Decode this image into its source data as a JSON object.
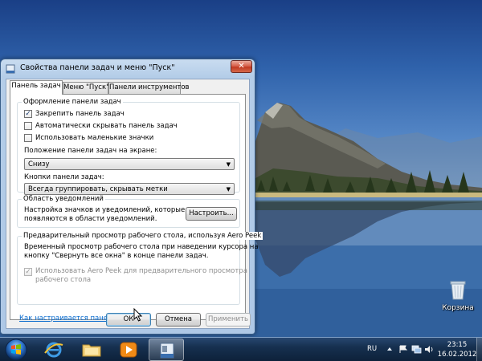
{
  "window": {
    "title": "Свойства панели задач и меню \"Пуск\"",
    "close_symbol": "✕"
  },
  "tabs": [
    {
      "label": "Панель задач",
      "active": true
    },
    {
      "label": "Меню \"Пуск\"",
      "active": false
    },
    {
      "label": "Панели инструментов",
      "active": false
    }
  ],
  "taskbar_appearance": {
    "caption": "Оформление панели задач",
    "lock_taskbar": {
      "label": "Закрепить панель задач",
      "checked": true,
      "mark": "✓"
    },
    "auto_hide": {
      "label": "Автоматически скрывать панель задач",
      "checked": false
    },
    "small_icons": {
      "label": "Использовать маленькие значки",
      "checked": false
    },
    "location_label": "Положение панели задач на экране:",
    "location_value": "Снизу",
    "buttons_label": "Кнопки панели задач:",
    "buttons_value": "Всегда группировать, скрывать метки"
  },
  "notification_area": {
    "caption": "Область уведомлений",
    "text_line1": "Настройка значков и уведомлений, которые",
    "text_line2": "появляются в области уведомлений.",
    "customize_button": "Настроить..."
  },
  "aero_peek": {
    "caption": "Предварительный просмотр рабочего стола, используя Aero Peek",
    "text_line1": "Временный просмотр рабочего стола при наведении курсора на",
    "text_line2": "кнопку \"Свернуть все окна\" в конце панели задач.",
    "checkbox_line1": "Использовать Aero Peek для предварительного просмотра",
    "checkbox_line2": "рабочего стола",
    "checked": true,
    "mark": "✓"
  },
  "help_link": "Как настраивается панель задач?",
  "buttons": {
    "ok": "ОК",
    "cancel": "Отмена",
    "apply": "Применить"
  },
  "desktop": {
    "recycle_bin_label": "Корзина"
  },
  "taskbar": {
    "language": "RU",
    "time": "23:15",
    "date": "16.02.2012",
    "pinned": [
      "internet-explorer-icon",
      "explorer-folder-icon",
      "media-player-icon",
      "taskbar-properties-icon"
    ],
    "active_task": "taskbar-properties-icon"
  },
  "colors": {
    "accent": "#3c7fb1",
    "link": "#0066cc",
    "close_button": "#c13a22",
    "taskbar": "#16304f"
  }
}
